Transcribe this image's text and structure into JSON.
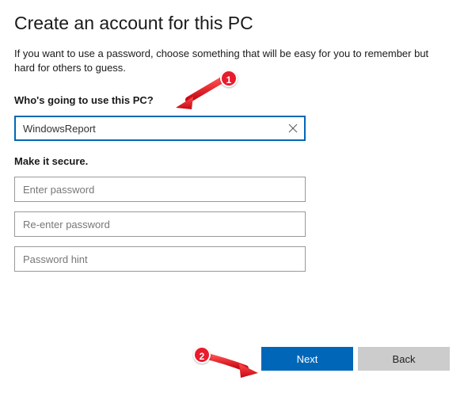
{
  "title": "Create an account for this PC",
  "subtitle": "If you want to use a password, choose something that will be easy for you to remember but hard for others to guess.",
  "section_user_label": "Who's going to use this PC?",
  "username_value": "WindowsReport",
  "section_secure_label": "Make it secure.",
  "password_placeholder": "Enter password",
  "reenter_placeholder": "Re-enter password",
  "hint_placeholder": "Password hint",
  "next_label": "Next",
  "back_label": "Back",
  "annotation1": "1",
  "annotation2": "2"
}
